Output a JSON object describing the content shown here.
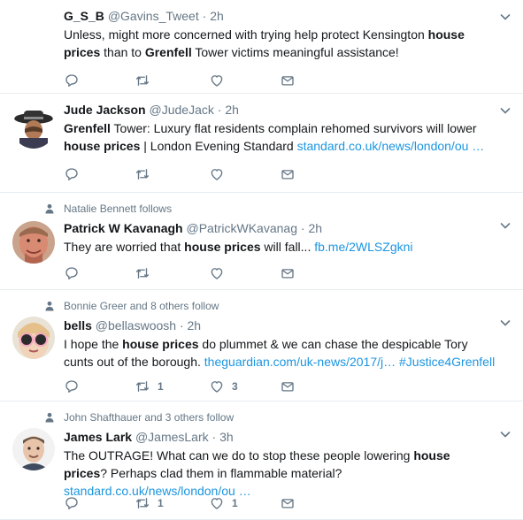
{
  "tweets": [
    {
      "context": "",
      "name": "G_S_B",
      "handle": "@Gavins_Tweet",
      "time": "2h",
      "segments": [
        {
          "t": "Unless, might more concerned with trying help protect Kensington "
        },
        {
          "t": "house prices",
          "b": true
        },
        {
          "t": " than to "
        },
        {
          "t": "Grenfell",
          "b": true
        },
        {
          "t": " Tower victims meaningful assistance!"
        }
      ],
      "reply_count": "",
      "retweet_count": "",
      "like_count": ""
    },
    {
      "context": "",
      "name": "Jude Jackson",
      "handle": "@JudeJack",
      "time": "2h",
      "segments": [
        {
          "t": "Grenfell",
          "b": true
        },
        {
          "t": " Tower: Luxury flat residents complain rehomed survivors will lower "
        },
        {
          "t": "house prices",
          "b": true
        },
        {
          "t": " | London Evening Standard "
        },
        {
          "t": "standard.co.uk/news/london/ou …",
          "link": true
        }
      ],
      "reply_count": "",
      "retweet_count": "",
      "like_count": ""
    },
    {
      "context": "Natalie Bennett follows",
      "name": "Patrick W Kavanagh",
      "handle": "@PatrickWKavanag",
      "time": "2h",
      "segments": [
        {
          "t": "They are worried that "
        },
        {
          "t": "house prices",
          "b": true
        },
        {
          "t": " will fall... "
        },
        {
          "t": "fb.me/2WLSZgkni",
          "link": true
        }
      ],
      "reply_count": "",
      "retweet_count": "",
      "like_count": ""
    },
    {
      "context": "Bonnie Greer and 8 others follow",
      "name": "bells",
      "handle": "@bellaswoosh",
      "time": "2h",
      "segments": [
        {
          "t": "I hope the "
        },
        {
          "t": "house prices",
          "b": true
        },
        {
          "t": " do plummet & we can chase the despicable Tory cunts out of the borough. "
        },
        {
          "t": "theguardian.com/uk-news/2017/j…",
          "link": true
        },
        {
          "t": " "
        },
        {
          "t": "#Justice4Grenfell",
          "link": true
        }
      ],
      "reply_count": "",
      "retweet_count": "1",
      "like_count": "3"
    },
    {
      "context": "John Shafthauer and 3 others follow",
      "name": "James Lark",
      "handle": "@JamesLark",
      "time": "3h",
      "segments": [
        {
          "t": "The OUTRAGE! What can we do to stop these people lowering "
        },
        {
          "t": "house prices",
          "b": true
        },
        {
          "t": "? Perhaps clad them in flammable material? "
        },
        {
          "t": "standard.co.uk/news/london/ou …",
          "link": true
        }
      ],
      "reply_count": "",
      "retweet_count": "1",
      "like_count": "1"
    }
  ],
  "icons": {
    "reply": "reply-icon",
    "retweet": "retweet-icon",
    "like": "heart-icon",
    "dm": "envelope-icon",
    "caret": "chevron-down-icon",
    "follow_context": "person-icon"
  },
  "colors": {
    "link": "#1b95e0",
    "muted": "#657786",
    "text": "#14171a",
    "divider": "#e6ecf0"
  }
}
